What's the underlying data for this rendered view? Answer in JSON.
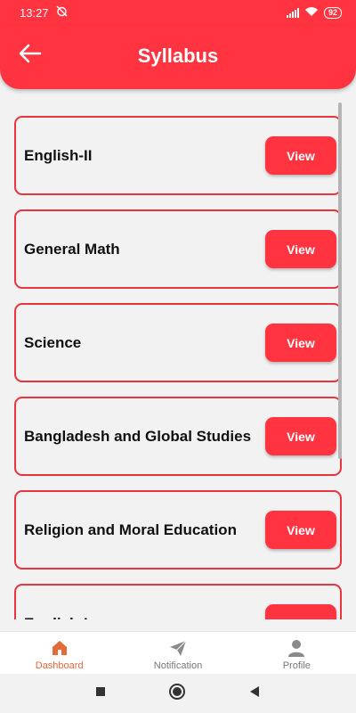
{
  "status_bar": {
    "time": "13:27",
    "battery": "92"
  },
  "header": {
    "title": "Syllabus"
  },
  "subjects": [
    {
      "name": "English-II",
      "action": "View"
    },
    {
      "name": "General Math",
      "action": "View"
    },
    {
      "name": "Science",
      "action": "View"
    },
    {
      "name": "Bangladesh and Global Studies",
      "action": "View"
    },
    {
      "name": "Religion and Moral Education",
      "action": "View"
    },
    {
      "name": "English-I",
      "action": "View"
    }
  ],
  "bottom_nav": {
    "items": [
      {
        "label": "Dashboard",
        "icon": "home-icon",
        "active": true
      },
      {
        "label": "Notification",
        "icon": "paper-plane-icon",
        "active": false
      },
      {
        "label": "Profile",
        "icon": "person-icon",
        "active": false
      }
    ]
  },
  "colors": {
    "primary": "#ff3440",
    "card_border": "#e8343d",
    "active_tab": "#e36a3a"
  }
}
